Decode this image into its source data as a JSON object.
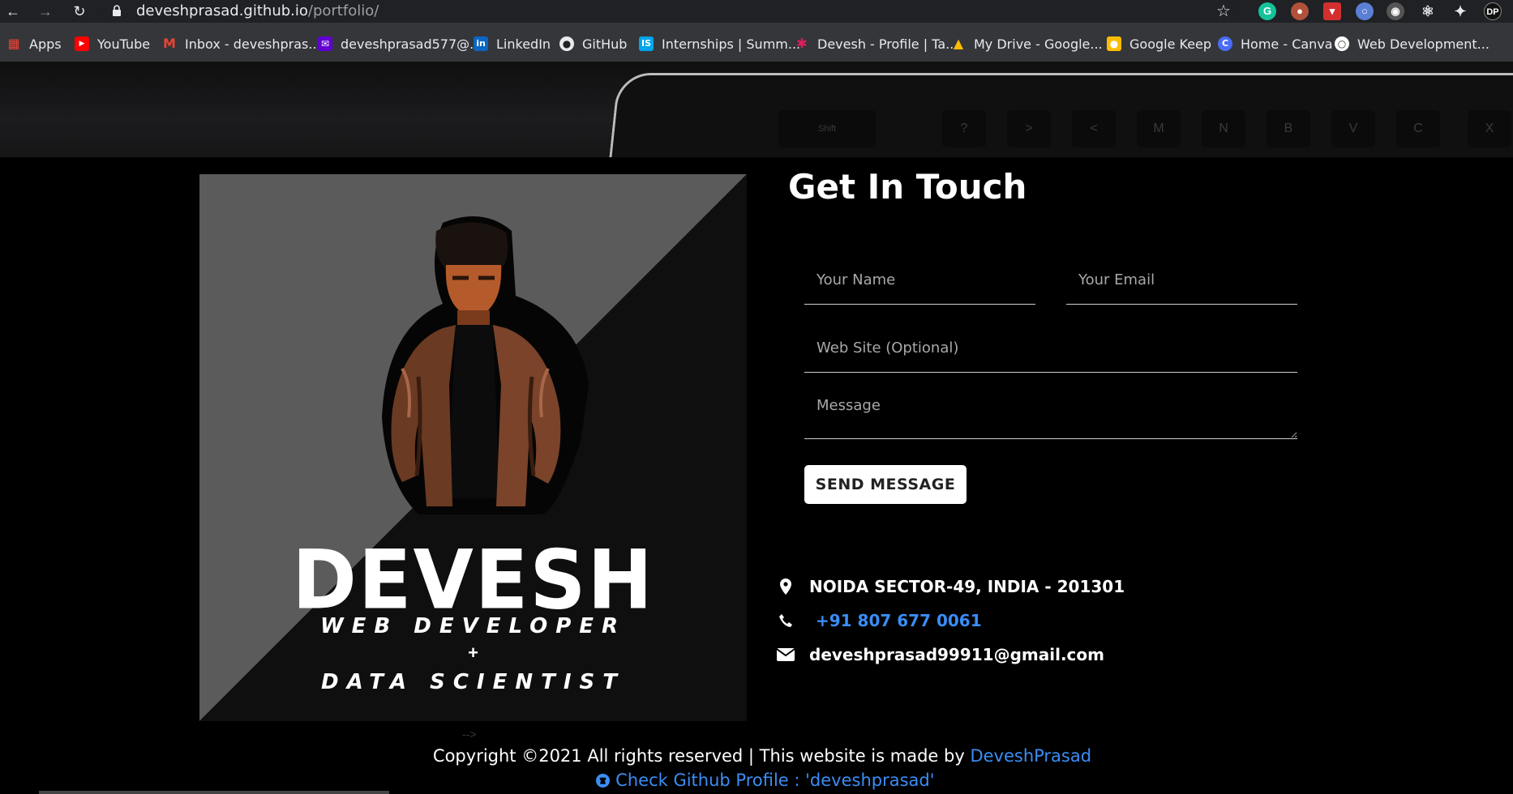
{
  "browser": {
    "url_host": "deveshprasad.github.io",
    "url_path": "/portfolio/",
    "profile_initials": "DP"
  },
  "bookmarks": [
    {
      "label": "Apps",
      "icon": "apps-grid-icon"
    },
    {
      "label": "YouTube",
      "icon": "youtube-icon"
    },
    {
      "label": "Inbox - deveshpras...",
      "icon": "gmail-icon"
    },
    {
      "label": "deveshprasad577@...",
      "icon": "yahoo-mail-icon"
    },
    {
      "label": "LinkedIn",
      "icon": "linkedin-icon"
    },
    {
      "label": "GitHub",
      "icon": "github-icon"
    },
    {
      "label": "Internships | Summ...",
      "icon": "internshala-icon"
    },
    {
      "label": "Devesh - Profile | Ta...",
      "icon": "slack-icon"
    },
    {
      "label": "My Drive - Google...",
      "icon": "google-drive-icon"
    },
    {
      "label": "Google Keep",
      "icon": "google-keep-icon"
    },
    {
      "label": "Home - Canva",
      "icon": "canva-icon"
    },
    {
      "label": "Web Development...",
      "icon": "web-dev-icon"
    }
  ],
  "hero": {
    "keys": [
      "X",
      "C",
      "V",
      "B",
      "N",
      "M",
      "<",
      ">",
      "?",
      "Shift"
    ]
  },
  "profile": {
    "name": "DEVESH",
    "line1": "WEB DEVELOPER",
    "plus": "+",
    "line2": "DATA SCIENTIST"
  },
  "contact": {
    "title": "Get In Touch",
    "name_placeholder": "Your Name",
    "email_placeholder": "Your Email",
    "website_placeholder": "Web Site (Optional)",
    "message_placeholder": "Message",
    "send_label": "SEND MESSAGE"
  },
  "info": {
    "address": "NOIDA SECTOR-49, INDIA - 201301",
    "phone": "+91 807 677 0061",
    "email": "deveshprasad99911@gmail.com"
  },
  "footer": {
    "comment_fragment": "-->",
    "copyright": "Copyright ©2021 All rights reserved | This website is made by ",
    "author_link": "DeveshPrasad",
    "github_link": "Check Github Profile : 'deveshprasad'"
  },
  "colors": {
    "link": "#3a8df5",
    "background": "#000000",
    "chrome_dark": "#202124",
    "bookmark_bar": "#35363a"
  }
}
